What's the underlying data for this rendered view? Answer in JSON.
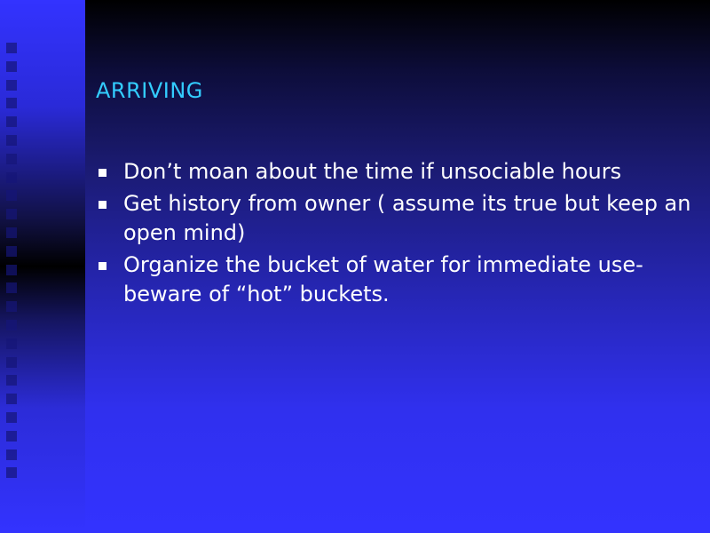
{
  "slide": {
    "title": "ARRIVING",
    "bullets": [
      {
        "text": "Don’t moan about the time if unsociable hours"
      },
      {
        "text": "Get history from owner ( assume its true but keep an open mind)"
      },
      {
        "text": "Organize the bucket of water for immediate use-beware of “hot” buckets."
      }
    ]
  },
  "colors": {
    "title": "#33ccff",
    "text": "#ffffff",
    "background_bottom": "#3333ff",
    "background_top": "#000000"
  }
}
